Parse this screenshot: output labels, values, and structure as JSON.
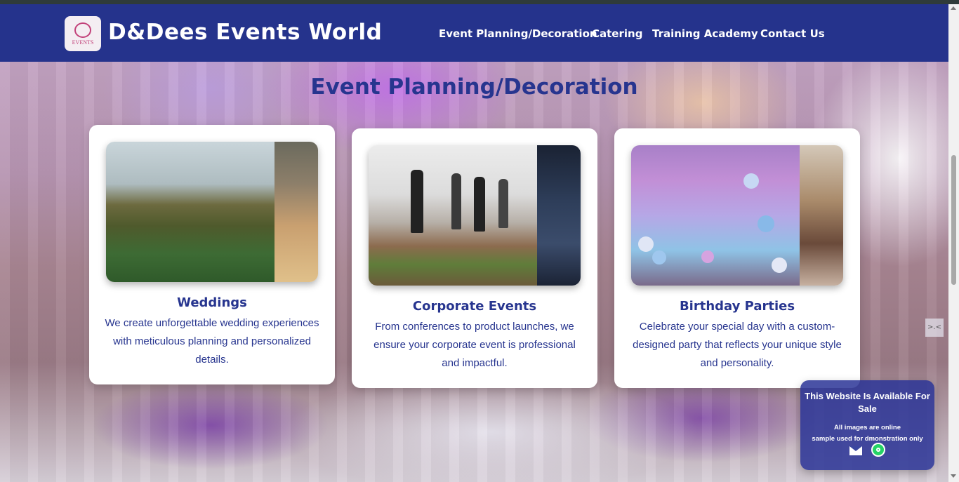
{
  "header": {
    "brand": "D&Dees Events World",
    "logo_text": "EVENTS",
    "nav": [
      {
        "label": "Event Planning/Decoration"
      },
      {
        "label": "Catering"
      },
      {
        "label": "Training Academy"
      },
      {
        "label": "Contact Us"
      }
    ]
  },
  "section": {
    "title": "Event Planning/Decoration"
  },
  "cards": [
    {
      "title": "Weddings",
      "text": "We create unforgettable wedding experiences with meticulous planning and personalized details."
    },
    {
      "title": "Corporate Events",
      "text": "From conferences to product launches, we ensure your corporate event is professional and impactful."
    },
    {
      "title": "Birthday Parties",
      "text": "Celebrate your special day with a custom-designed party that reflects your unique style and personality."
    }
  ],
  "sale_widget": {
    "title": "This Website Is Available For Sale",
    "note_line1": "All images are online",
    "note_line2": "sample used for dmonstration only",
    "icons": [
      "mail-icon",
      "whatsapp-icon"
    ]
  },
  "side_handle": {
    "label": ">.<"
  },
  "colors": {
    "header_bg": "#25338c",
    "accent_text": "#27358f",
    "card_bg": "#ffffff"
  }
}
